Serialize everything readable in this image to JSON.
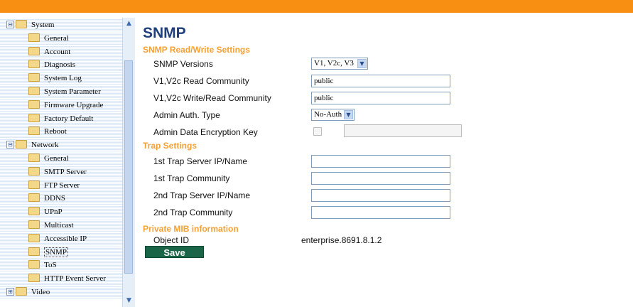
{
  "colors": {
    "top_bar": "#f98f12",
    "title": "#1f3f7b",
    "section_heading": "#f5a033",
    "save_button": "#1a6447"
  },
  "tree": {
    "system": {
      "label": "System",
      "expander": "⊟",
      "children": [
        "General",
        "Account",
        "Diagnosis",
        "System Log",
        "System Parameter",
        "Firmware Upgrade",
        "Factory Default",
        "Reboot"
      ]
    },
    "network": {
      "label": "Network",
      "expander": "⊟",
      "children": [
        "General",
        "SMTP Server",
        "FTP Server",
        "DDNS",
        "UPnP",
        "Multicast",
        "Accessible IP",
        "SNMP",
        "ToS",
        "HTTP Event Server"
      ]
    },
    "video": {
      "label": "Video",
      "expander": "⊞"
    },
    "selected": "SNMP"
  },
  "page": {
    "title": "SNMP",
    "rw_heading": "SNMP Read/Write Settings",
    "versions": {
      "label": "SNMP Versions",
      "value": "V1, V2c, V3"
    },
    "read_community": {
      "label": "V1,V2c Read Community",
      "value": "public"
    },
    "write_community": {
      "label": "V1,V2c Write/Read Community",
      "value": "public"
    },
    "auth_type": {
      "label": "Admin Auth. Type",
      "value": "No-Auth"
    },
    "encryption_key": {
      "label": "Admin Data Encryption Key",
      "checked": false,
      "value": ""
    },
    "trap_heading": "Trap Settings",
    "trap1_server": {
      "label": "1st Trap Server IP/Name",
      "value": ""
    },
    "trap1_community": {
      "label": "1st Trap Community",
      "value": ""
    },
    "trap2_server": {
      "label": "2nd Trap Server IP/Name",
      "value": ""
    },
    "trap2_community": {
      "label": "2nd Trap Community",
      "value": ""
    },
    "mib_heading": "Private MIB information",
    "object_id": {
      "label": "Object ID",
      "value": "enterprise.8691.8.1.2"
    },
    "save_label": "Save"
  }
}
